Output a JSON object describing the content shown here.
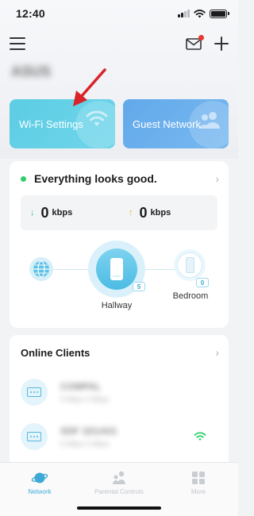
{
  "status_bar": {
    "time": "12:40",
    "icons": [
      "cellular-signal-icon",
      "wifi-icon",
      "battery-icon"
    ]
  },
  "header": {
    "menu_icon": "hamburger-icon",
    "mail_icon": "mail-icon",
    "add_icon": "plus-icon",
    "network_name": "ASUS"
  },
  "quick_actions": [
    {
      "label": "Wi-Fi Settings",
      "icon": "wifi-icon",
      "color": "#5ccde4"
    },
    {
      "label": "Guest Network",
      "icon": "users-icon",
      "color": "#62a9ea"
    }
  ],
  "status": {
    "message": "Everything looks good.",
    "indicator_color": "#2fcf6e",
    "download": {
      "value": "0",
      "unit": "kbps",
      "icon": "arrow-down-icon"
    },
    "upload": {
      "value": "0",
      "unit": "kbps",
      "icon": "arrow-up-icon"
    }
  },
  "topology": {
    "internet_icon": "globe-icon",
    "nodes": [
      {
        "name": "Hallway",
        "count": "5",
        "icon": "deco-device-icon"
      },
      {
        "name": "Bedroom",
        "count": "0",
        "icon": "deco-device-icon"
      }
    ]
  },
  "clients": {
    "title": "Online Clients",
    "items": [
      {
        "name": "COMPAL",
        "meta": "5 Mbps   0 Mbps",
        "icon": "device-icon"
      },
      {
        "name": "SDF 1D1A01",
        "meta": "5 Mbps   0 Mbps",
        "icon": "device-icon"
      }
    ]
  },
  "tabs": [
    {
      "label": "Network",
      "icon": "planet-icon",
      "active": true
    },
    {
      "label": "Parental Controls",
      "icon": "family-icon",
      "active": false
    },
    {
      "label": "More",
      "icon": "grid-icon",
      "active": false
    }
  ],
  "colors": {
    "accent": "#3fa9d6",
    "annotation_arrow": "#d9232a"
  }
}
